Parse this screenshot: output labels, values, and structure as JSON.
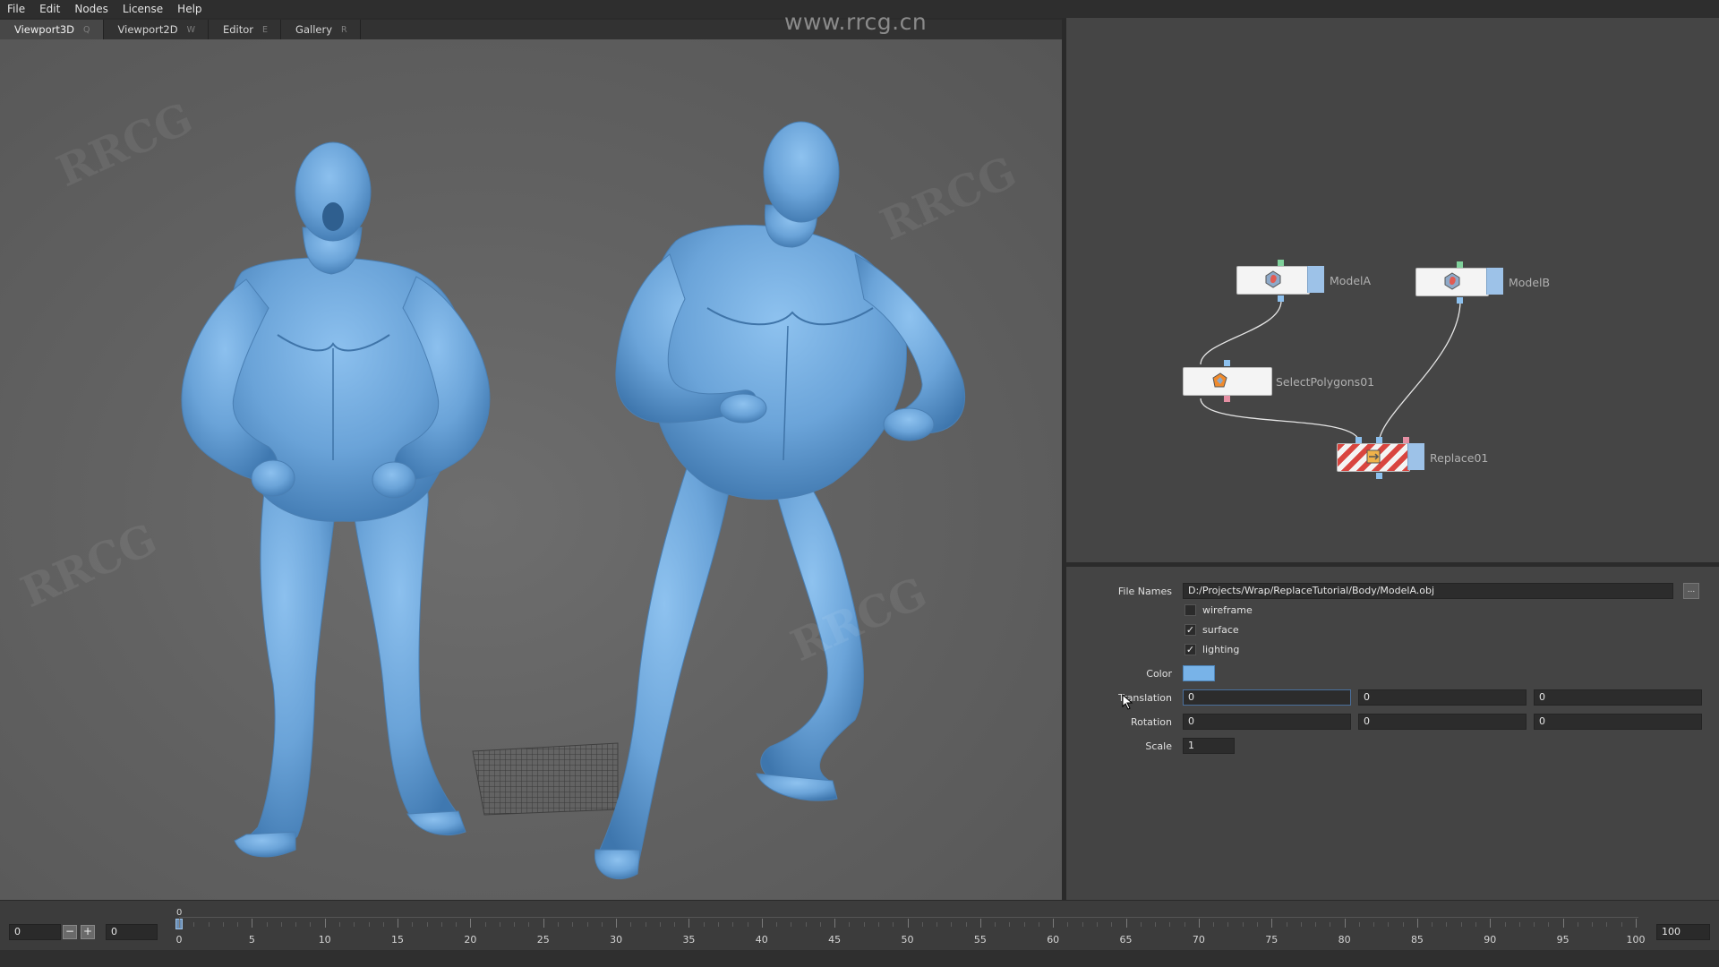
{
  "menu": [
    "File",
    "Edit",
    "Nodes",
    "License",
    "Help"
  ],
  "tabs": [
    {
      "label": "Viewport3D",
      "key": "Q"
    },
    {
      "label": "Viewport2D",
      "key": "W"
    },
    {
      "label": "Editor",
      "key": "E"
    },
    {
      "label": "Gallery",
      "key": "R"
    }
  ],
  "watermark": "www.rrcg.cn",
  "watermark_overlay": "RRCG",
  "nodes": {
    "model_a": "ModelA",
    "model_b": "ModelB",
    "select_polygons": "SelectPolygons01",
    "replace": "Replace01"
  },
  "properties": {
    "file_names_label": "File Names",
    "file_names_value": "D:/Projects/Wrap/ReplaceTutorial/Body/ModelA.obj",
    "browse_label": "...",
    "wireframe_label": "wireframe",
    "wireframe_checked": false,
    "surface_label": "surface",
    "surface_checked": true,
    "lighting_label": "lighting",
    "lighting_checked": true,
    "color_label": "Color",
    "color_value": "#78b3e8",
    "translation_label": "Translation",
    "translation": [
      "0",
      "0",
      "0"
    ],
    "rotation_label": "Rotation",
    "rotation": [
      "0",
      "0",
      "0"
    ],
    "scale_label": "Scale",
    "scale": "1"
  },
  "timeline": {
    "current_frame": "0",
    "start_field": "0",
    "end_field": "0",
    "max_frame": "100",
    "minus": "−",
    "plus": "+",
    "ticks": [
      "0",
      "5",
      "10",
      "15",
      "20",
      "25",
      "30",
      "35",
      "40",
      "45",
      "50",
      "55",
      "60",
      "65",
      "70",
      "75",
      "80",
      "85",
      "90",
      "95",
      "100"
    ]
  },
  "colors": {
    "model_blue": "#6fa7dc",
    "node_cap": "#9dc2e8"
  }
}
